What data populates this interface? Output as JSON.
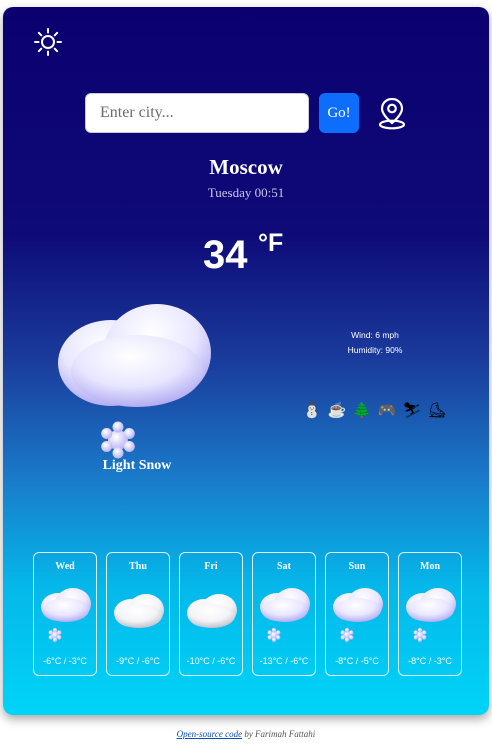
{
  "search": {
    "placeholder": "Enter city...",
    "go_label": "Go!"
  },
  "location": {
    "city": "Moscow",
    "datetime": "Tuesday 00:51"
  },
  "current": {
    "temperature": "34",
    "unit": "°F",
    "condition": "Light Snow",
    "icon": "cloud-snow-icon",
    "wind": "Wind: 6 mph",
    "humidity": "Humidity: 90%"
  },
  "activities": [
    {
      "name": "snowman-icon",
      "glyph": "⛄"
    },
    {
      "name": "hot-drink-icon",
      "glyph": "☕"
    },
    {
      "name": "winter-tree-icon",
      "glyph": "🌲"
    },
    {
      "name": "gamepad-icon",
      "glyph": "🎮"
    },
    {
      "name": "skiing-icon",
      "glyph": "⛷"
    },
    {
      "name": "ice-skating-icon",
      "glyph": "⛸"
    }
  ],
  "forecast": [
    {
      "day": "Wed",
      "temps": "-6°C / -3°C",
      "icon": "cloud-snow-icon",
      "snow": true
    },
    {
      "day": "Thu",
      "temps": "-9°C / -6°C",
      "icon": "cloud-icon",
      "snow": false
    },
    {
      "day": "Fri",
      "temps": "-10°C / -6°C",
      "icon": "cloud-icon",
      "snow": false
    },
    {
      "day": "Sat",
      "temps": "-13°C / -6°C",
      "icon": "cloud-snow-icon",
      "snow": true
    },
    {
      "day": "Sun",
      "temps": "-8°C / -5°C",
      "icon": "cloud-snow-icon",
      "snow": true
    },
    {
      "day": "Mon",
      "temps": "-8°C / -3°C",
      "icon": "cloud-snow-icon",
      "snow": true
    }
  ],
  "footer": {
    "link_text": "Open-source code",
    "by_text": "by Farimah Fattahi"
  },
  "colors": {
    "accent": "#0d6efd",
    "bg_top": "#0c0070",
    "bg_bottom": "#00d4f8"
  }
}
